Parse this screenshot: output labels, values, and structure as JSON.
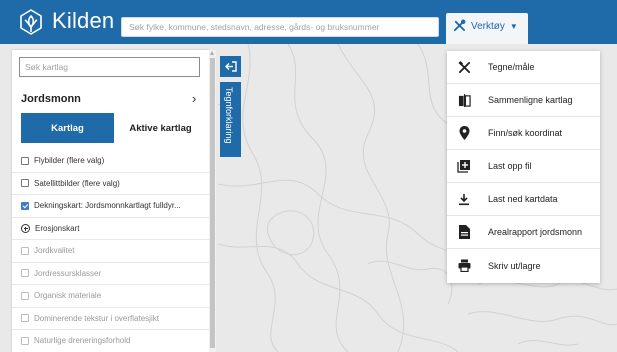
{
  "app": {
    "title": "Kilden"
  },
  "header": {
    "search_placeholder": "Søk fylke, kommune, stedsnavn, adresse, gårds- og bruksnummer",
    "tools_label": "Verktøy"
  },
  "panel": {
    "search_placeholder": "Søk kartlag",
    "category": "Jordsmonn",
    "tabs": [
      {
        "label": "Kartlag",
        "active": true
      },
      {
        "label": "Aktive kartlag",
        "active": false
      }
    ],
    "layers": [
      {
        "label": "Flybilder (flere valg)",
        "state": "unchecked",
        "enabled": true
      },
      {
        "label": "Satellittbilder (flere valg)",
        "state": "unchecked",
        "enabled": true
      },
      {
        "label": "Dekningskart: Jordsmonnkartlagt fulldyr...",
        "state": "checked",
        "enabled": true
      },
      {
        "label": "Erosjonskart",
        "state": "group",
        "enabled": true
      },
      {
        "label": "Jordkvalitet",
        "state": "unchecked",
        "enabled": false
      },
      {
        "label": "Jordressursklasser",
        "state": "unchecked",
        "enabled": false
      },
      {
        "label": "Organisk materiale",
        "state": "unchecked",
        "enabled": false
      },
      {
        "label": "Dominerende tekstur i overflatesjikt",
        "state": "unchecked",
        "enabled": false
      },
      {
        "label": "Naturlige dreneringsforhold",
        "state": "unchecked",
        "enabled": false
      }
    ]
  },
  "legend_tab": {
    "label": "Tegnforklaring"
  },
  "tools_menu": {
    "items": [
      {
        "label": "Tegne/måle",
        "icon": "draw-measure-icon"
      },
      {
        "label": "Sammenligne kartlag",
        "icon": "compare-icon"
      },
      {
        "label": "Finn/søk koordinat",
        "icon": "map-pin-icon"
      },
      {
        "label": "Last opp fil",
        "icon": "upload-file-icon"
      },
      {
        "label": "Last ned kartdata",
        "icon": "download-icon"
      },
      {
        "label": "Arealrapport jordsmonn",
        "icon": "report-icon"
      },
      {
        "label": "Skriv ut/lagre",
        "icon": "print-icon"
      }
    ]
  },
  "colors": {
    "brand": "#1f6aa8",
    "map_bg": "#e9e9e9"
  }
}
